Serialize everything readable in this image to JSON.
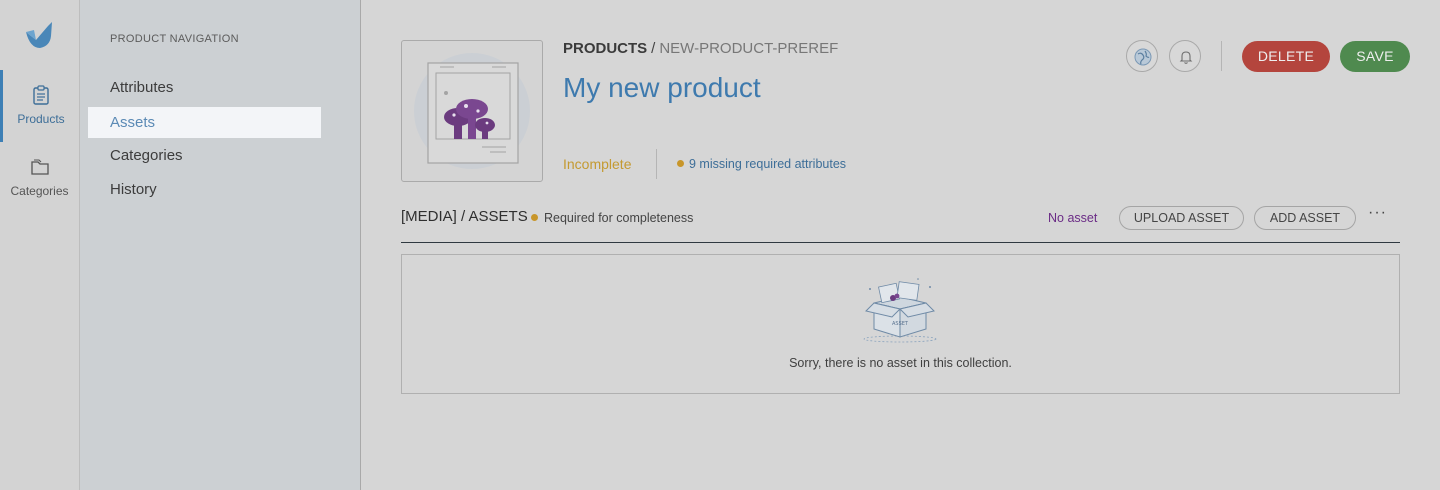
{
  "rail": {
    "items": [
      {
        "label": "Products",
        "icon": "clipboard-icon",
        "active": true
      },
      {
        "label": "Categories",
        "icon": "folder-icon",
        "active": false
      }
    ]
  },
  "product_nav": {
    "title": "PRODUCT NAVIGATION",
    "items": [
      {
        "label": "Attributes"
      },
      {
        "label": "Assets",
        "active": true
      },
      {
        "label": "Categories"
      },
      {
        "label": "History"
      }
    ]
  },
  "header": {
    "breadcrumb_root": "PRODUCTS",
    "breadcrumb_sep": "/",
    "breadcrumb_sub": "NEW-PRODUCT-PREREF",
    "title": "My new product",
    "status": "Incomplete",
    "missing": "9 missing required attributes",
    "delete_label": "DELETE",
    "save_label": "SAVE"
  },
  "section": {
    "title": "[MEDIA] / ASSETS",
    "required": "Required for completeness",
    "no_asset": "No asset",
    "upload_label": "UPLOAD ASSET",
    "add_label": "ADD ASSET",
    "more_label": "···",
    "empty_message": "Sorry, there is no asset in this collection.",
    "illustration_text": "ASSET"
  },
  "colors": {
    "accent": "#3e7aae",
    "delete": "#b4453d",
    "save": "#4f8a4f",
    "warning": "#c8962a",
    "no_asset": "#6b2c86"
  }
}
